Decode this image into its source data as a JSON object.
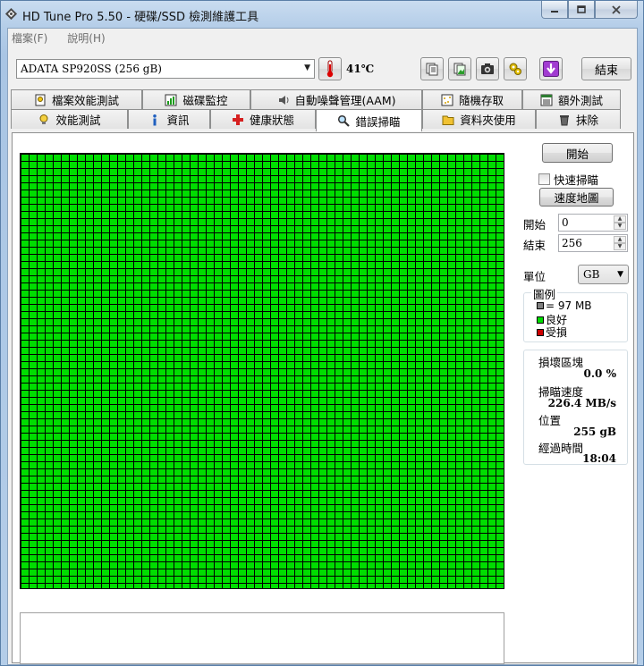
{
  "window": {
    "title": "HD Tune Pro 5.50 - 硬碟/SSD 檢測維護工具",
    "minimize_icon": "minimize-icon",
    "maximize_icon": "maximize-icon",
    "close_icon": "close-icon"
  },
  "menu": {
    "file": "檔案(F)",
    "help": "說明(H)"
  },
  "toolbar": {
    "drive": "ADATA  SP920SS (256 gB)",
    "temperature": "41℃",
    "exit_label": "結束"
  },
  "tabs": {
    "row1": [
      "檔案效能測試",
      "磁碟監控",
      "自動噪聲管理(AAM)",
      "隨機存取",
      "額外測試"
    ],
    "row2": [
      "效能測試",
      "資訊",
      "健康狀態",
      "錯誤掃瞄",
      "資料夾使用",
      "抹除"
    ],
    "active": "錯誤掃瞄"
  },
  "scan": {
    "start_button": "開始",
    "quick_scan": "快速掃瞄",
    "speed_map_button": "速度地圖",
    "start_label": "開始",
    "start_value": "0",
    "end_label": "結束",
    "end_value": "256",
    "unit_label": "單位",
    "unit_value": "GB",
    "legend_title": "圖例",
    "legend_block": "= 97 MB",
    "legend_good": "良好",
    "legend_damaged": "受損",
    "damaged_blocks_label": "損壞區塊",
    "damaged_blocks_value": "0.0 %",
    "scan_speed_label": "掃瞄速度",
    "scan_speed_value": "226.4 MB/s",
    "position_label": "位置",
    "position_value": "255 gB",
    "elapsed_label": "經過時間",
    "elapsed_value": "18:04"
  },
  "colors": {
    "good": "#00dd00",
    "damaged": "#cc0000",
    "block": "#808080"
  }
}
